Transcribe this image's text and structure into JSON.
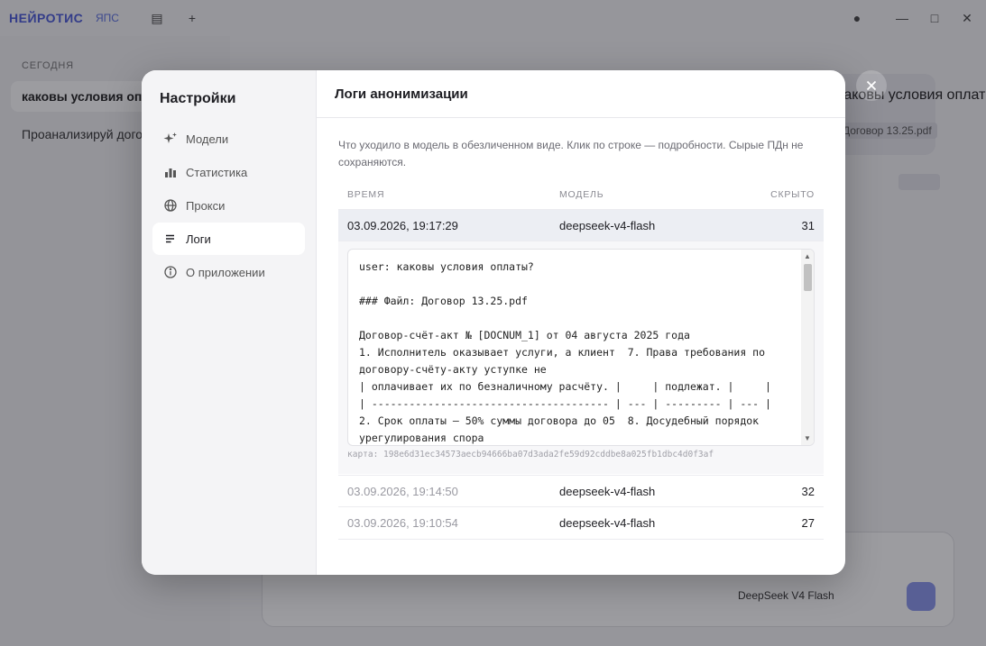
{
  "background": {
    "logo": "НЕЙРОТИС",
    "logo_sub": "ЯПС",
    "section_label": "СЕГОДНЯ",
    "chat_active": "каковы условия оплаты?",
    "chat_second": "Проанализируй договор",
    "bubble_text": "каковы условия оплаты?",
    "bubble_file": "Договор 13.25.pdf",
    "model_selector": "DeepSeek V4 Flash"
  },
  "sidebar": {
    "title": "Настройки",
    "items": [
      {
        "label": "Модели",
        "icon": "sparkle-icon"
      },
      {
        "label": "Статистика",
        "icon": "bar-chart-icon"
      },
      {
        "label": "Прокси",
        "icon": "globe-icon"
      },
      {
        "label": "Логи",
        "icon": "list-icon"
      },
      {
        "label": "О приложении",
        "icon": "info-icon"
      }
    ],
    "active": "Логи"
  },
  "content": {
    "title": "Логи анонимизации",
    "description": "Что уходило в модель в обезличенном виде. Клик по строке — подробности. Сырые ПДн не сохраняются."
  },
  "table": {
    "headers": {
      "time": "ВРЕМЯ",
      "model": "МОДЕЛЬ",
      "hidden": "СКРЫТО"
    },
    "rows": [
      {
        "time": "03.09.2026, 19:17:29",
        "model": "deepseek-v4-flash",
        "hidden": "31"
      },
      {
        "time": "03.09.2026, 19:14:50",
        "model": "deepseek-v4-flash",
        "hidden": "32"
      },
      {
        "time": "03.09.2026, 19:10:54",
        "model": "deepseek-v4-flash",
        "hidden": "27"
      }
    ],
    "selected_index": 0
  },
  "detail": {
    "text": "user: каковы условия оплаты?\n\n### Файл: Договор 13.25.pdf\n\nДоговор-счёт-акт № [DOCNUM_1] от 04 августа 2025 года\n1. Исполнитель оказывает услуги, а клиент  7. Права требования по договору-счёту-акту уступке не\n| оплачивает их по безналичному расчёту. |     | подлежат. |     |\n| -------------------------------------- | --- | --------- | --- |\n2. Срок оплаты — 50% суммы договора до 05  8. Досудебный порядок урегулирования спора",
    "map": "карта: 198e6d31ec34573aecb94666ba07d3ada2fe59d92cddbe8a025fb1dbc4d0f3af"
  }
}
